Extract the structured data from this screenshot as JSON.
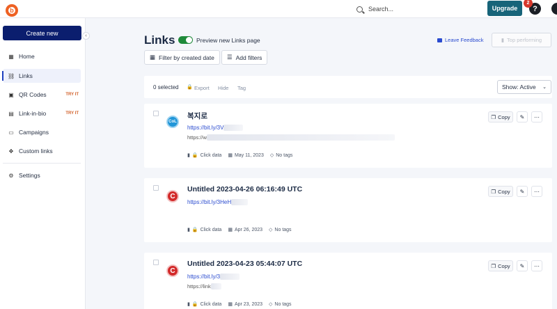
{
  "topbar": {
    "logo_letter": "b",
    "search_label": "Search...",
    "upgrade_label": "Upgrade",
    "notification_count": "2",
    "help_label": "?"
  },
  "sidebar": {
    "create_label": "Create new",
    "items": [
      {
        "label": "Home",
        "icon": "grid-icon",
        "glyph": "▦",
        "badge": ""
      },
      {
        "label": "Links",
        "icon": "link-icon",
        "glyph": "⛓",
        "badge": ""
      },
      {
        "label": "QR Codes",
        "icon": "qr-icon",
        "glyph": "▣",
        "badge": "TRY IT"
      },
      {
        "label": "Link-in-bio",
        "icon": "page-icon",
        "glyph": "▤",
        "badge": "TRY IT"
      },
      {
        "label": "Campaigns",
        "icon": "folder-icon",
        "glyph": "▭",
        "badge": ""
      },
      {
        "label": "Custom links",
        "icon": "custom-link-icon",
        "glyph": "✥",
        "badge": ""
      },
      {
        "label": "Settings",
        "icon": "gear-icon",
        "glyph": "⚙",
        "badge": ""
      }
    ]
  },
  "header": {
    "title": "Links",
    "preview_label": "Preview new Links page",
    "feedback_label": "Leave Feedback",
    "top_performing_label": "Top performing",
    "filter_date_label": "Filter by created date",
    "add_filters_label": "Add filters"
  },
  "selection": {
    "count_label": "0 selected",
    "export_label": "Export",
    "hide_label": "Hide",
    "tag_label": "Tag",
    "show_label": "Show: Active"
  },
  "links": [
    {
      "title": "복지로",
      "short_url": "https://bit.ly/3V",
      "long_url": "https://w",
      "favicon_text": "CoL",
      "click_label": "Click data",
      "date": "May 11, 2023",
      "tags": "No tags",
      "copy_label": "Copy"
    },
    {
      "title": "Untitled 2023-04-26 06:16:49 UTC",
      "short_url": "https://bit.ly/3HeH",
      "long_url": "",
      "favicon_text": "C",
      "click_label": "Click data",
      "date": "Apr 26, 2023",
      "tags": "No tags",
      "copy_label": "Copy"
    },
    {
      "title": "Untitled 2023-04-23 05:44:07 UTC",
      "short_url": "https://bit.ly/3",
      "long_url": "https://link",
      "favicon_text": "C",
      "click_label": "Click data",
      "date": "Apr 23, 2023",
      "tags": "No tags",
      "copy_label": "Copy"
    }
  ]
}
